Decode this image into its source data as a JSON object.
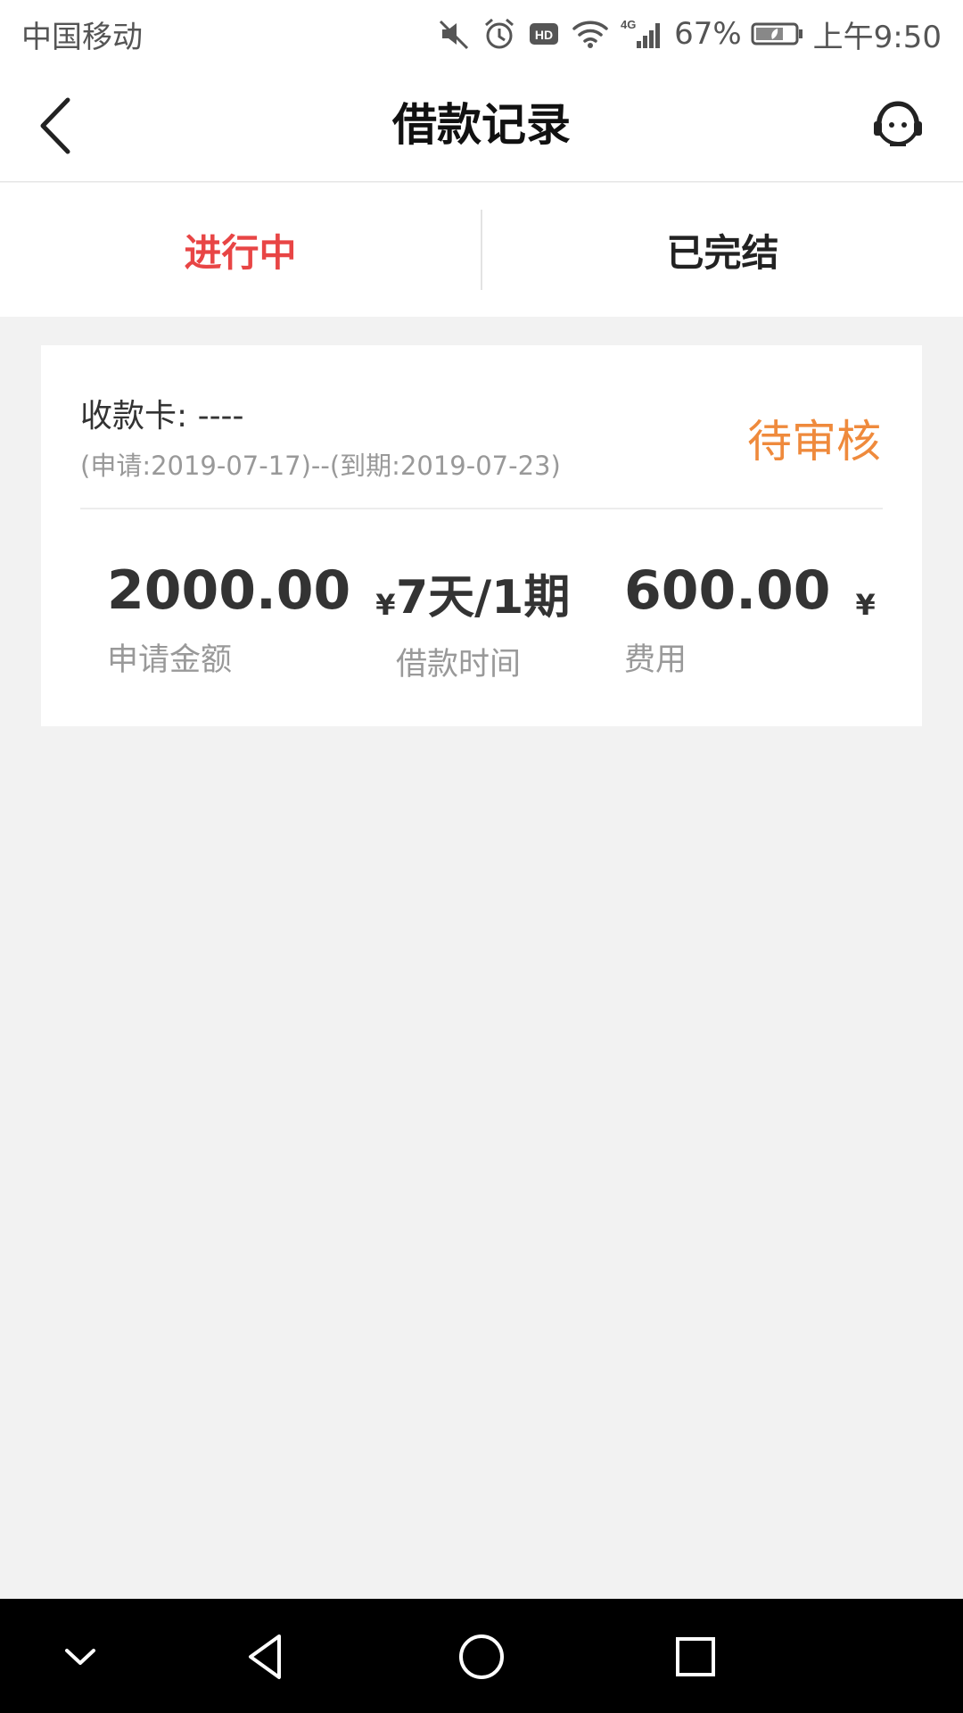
{
  "status_bar": {
    "carrier": "中国移动",
    "battery": "67%",
    "time": "上午9:50",
    "icons": [
      "mute-icon",
      "alarm-icon",
      "hd-icon",
      "wifi-icon",
      "signal-4g-icon",
      "battery-icon"
    ]
  },
  "header": {
    "title": "借款记录",
    "back_icon": "chevron-left-icon",
    "service_icon": "customer-service-icon"
  },
  "tabs": [
    {
      "label": "进行中",
      "active": true
    },
    {
      "label": "已完结",
      "active": false
    }
  ],
  "loan_card": {
    "card_label": "收款卡: ----",
    "dates": "(申请:2019-07-17)--(到期:2019-07-23)",
    "status": "待审核",
    "amount": {
      "value": "2000.00",
      "currency": "¥",
      "label": "申请金额"
    },
    "term": {
      "value": "7天/1期",
      "label": "借款时间"
    },
    "fee": {
      "value": "600.00",
      "currency": "¥",
      "label": "费用"
    }
  },
  "colors": {
    "active_tab": "#e84545",
    "status": "#ef8a3c",
    "background": "#f2f2f2"
  }
}
